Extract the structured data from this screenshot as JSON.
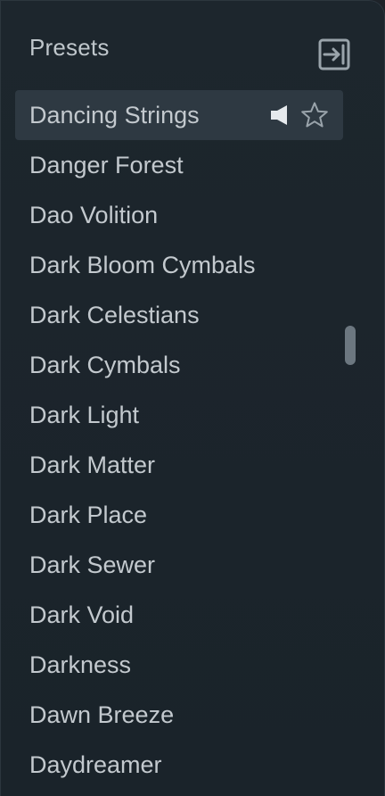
{
  "header": {
    "title": "Presets",
    "collapse_icon": "exit-panel-icon"
  },
  "presets": [
    {
      "label": "Dancing Strings",
      "selected": true
    },
    {
      "label": "Danger Forest"
    },
    {
      "label": "Dao Volition"
    },
    {
      "label": "Dark Bloom Cymbals"
    },
    {
      "label": "Dark Celestians"
    },
    {
      "label": "Dark Cymbals"
    },
    {
      "label": "Dark Light"
    },
    {
      "label": "Dark Matter"
    },
    {
      "label": "Dark Place"
    },
    {
      "label": "Dark Sewer"
    },
    {
      "label": "Dark Void"
    },
    {
      "label": "Darkness"
    },
    {
      "label": "Dawn Breeze"
    },
    {
      "label": "Daydreamer"
    }
  ],
  "selected_actions": {
    "preview_icon": "speaker-icon",
    "favorite_icon": "star-outline-icon"
  },
  "colors": {
    "background": "#1b242b",
    "selected_row": "#2e3942",
    "text": "#c3c9ce",
    "icon": "#9aa4ab",
    "scrollbar": "#6c7780"
  }
}
